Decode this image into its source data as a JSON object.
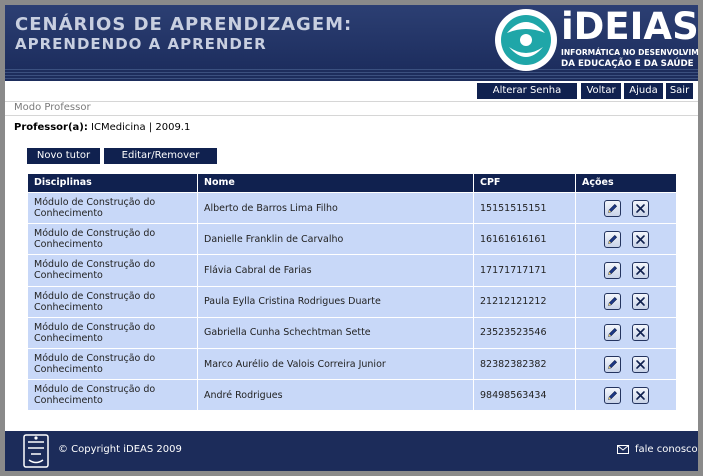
{
  "header": {
    "title_line1": "CENÁRIOS DE APRENDIZAGEM:",
    "title_line2": "APRENDENDO A APRENDER",
    "logo_word": "iDEIAS",
    "logo_sub1": "INFORMÁTICA NO DESENVOLVIMENTO",
    "logo_sub2": "DA EDUCAÇÃO E DA SAÚDE"
  },
  "nav": {
    "alterar_senha": "Alterar Senha",
    "voltar": "Voltar",
    "ajuda": "Ajuda",
    "sair": "Sair"
  },
  "mode_label": "Modo Professor",
  "professor": {
    "label": "Professor(a):",
    "value": "ICMedicina | 2009.1"
  },
  "actions": {
    "novo_tutor": "Novo tutor",
    "editar_remover": "Editar/Remover"
  },
  "table": {
    "headers": [
      "Disciplinas",
      "Nome",
      "CPF",
      "Ações"
    ],
    "rows": [
      {
        "disciplina": "Módulo de Construção do Conhecimento",
        "nome": "Alberto de Barros Lima Filho",
        "cpf": "15151515151"
      },
      {
        "disciplina": "Módulo de Construção do Conhecimento",
        "nome": "Danielle Franklin de Carvalho",
        "cpf": "16161616161"
      },
      {
        "disciplina": "Módulo de Construção do Conhecimento",
        "nome": "Flávia Cabral de Farias",
        "cpf": "17171717171"
      },
      {
        "disciplina": "Módulo de Construção do Conhecimento",
        "nome": "Paula Eylla Cristina Rodrigues Duarte",
        "cpf": "21212121212"
      },
      {
        "disciplina": "Módulo de Construção do Conhecimento",
        "nome": "Gabriella Cunha Schechtman Sette",
        "cpf": "23523523546"
      },
      {
        "disciplina": "Módulo de Construção do Conhecimento",
        "nome": "Marco Aurélio de Valois Correira Junior",
        "cpf": "82382382382"
      },
      {
        "disciplina": "Módulo de Construção do Conhecimento",
        "nome": "André Rodrigues",
        "cpf": "98498563434"
      }
    ]
  },
  "footer": {
    "copyright": "© Copyright iDEAS 2009",
    "fale_conosco": "fale conosco"
  },
  "colors": {
    "navy": "#10214f",
    "row_bg": "#c8d8f8",
    "header_bg": "#1a2a5a"
  },
  "icons": {
    "edit": "pencil-icon",
    "delete": "close-icon",
    "mail": "envelope-icon"
  }
}
